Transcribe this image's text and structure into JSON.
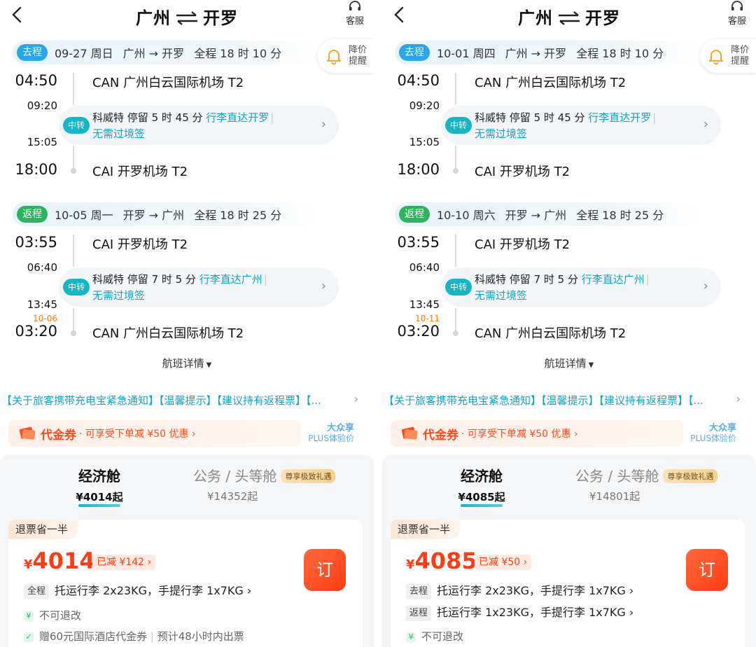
{
  "left": {
    "header": {
      "from": "广州",
      "to": "开罗",
      "service": "客服"
    },
    "alert": {
      "line1": "降价",
      "line2": "提醒"
    },
    "outbound": {
      "badge": "去程",
      "date": "09-27 周日",
      "route": "广州 → 开罗",
      "duration": "全程 18 时 10 分",
      "dep_time": "04:50",
      "dep_airport": "CAN 广州白云国际机场 T2",
      "transfer_arr": "09:20",
      "transfer_dep": "15:05",
      "transfer_tag": "中转",
      "transfer_city": "科威特",
      "transfer_stay": "停留 5 时 45 分",
      "transfer_bag": "行李直达开罗",
      "transfer_visa": "无需过境签",
      "arr_day": "",
      "arr_time": "18:00",
      "arr_airport": "CAI 开罗机场 T2"
    },
    "inbound": {
      "badge": "返程",
      "date": "10-05 周一",
      "route": "开罗 → 广州",
      "duration": "全程 18 时 25 分",
      "dep_time": "03:55",
      "dep_airport": "CAI 开罗机场 T2",
      "transfer_arr": "06:40",
      "transfer_dep": "13:45",
      "transfer_tag": "中转",
      "transfer_city": "科威特",
      "transfer_stay": "停留 7 时 5 分",
      "transfer_bag": "行李直达广州",
      "transfer_visa": "无需过境签",
      "arr_day": "10-06",
      "arr_time": "03:20",
      "arr_airport": "CAN 广州白云国际机场 T2"
    },
    "flight_detail": "航班详情",
    "notice": "【关于旅客携带充电宝紧急通知】【温馨提示】【建议持有返程票】【...",
    "coupon": {
      "title": "代金券",
      "desc": "· 可享受下单减 ¥50 优惠 ›"
    },
    "plus": {
      "line1": "大众享",
      "line2": "PLUS体验价"
    },
    "cabins": {
      "economy": {
        "name": "经济舱",
        "price": "¥4014起"
      },
      "business": {
        "name": "公务 / 头等舱",
        "vip": "尊享极致礼遇",
        "price": "¥14352起"
      }
    },
    "fare": {
      "refund": "退票省一半",
      "yen": "¥",
      "price": "4014",
      "discount": "已减  ¥142 ›",
      "book": "订",
      "bag1_tag": "全程",
      "bag1": "托运行李 2x23KG，手提行李 1x7KG ›",
      "cond1": "不可退改",
      "cond2": "赠60元国际酒店代金券",
      "cond2b": "预计48小时内出票"
    }
  },
  "right": {
    "header": {
      "from": "广州",
      "to": "开罗",
      "service": "客服"
    },
    "alert": {
      "line1": "降价",
      "line2": "提醒"
    },
    "outbound": {
      "badge": "去程",
      "date": "10-01 周四",
      "route": "广州 → 开罗",
      "duration": "全程 18 时 10 分",
      "dep_time": "04:50",
      "dep_airport": "CAN 广州白云国际机场 T2",
      "transfer_arr": "09:20",
      "transfer_dep": "15:05",
      "transfer_tag": "中转",
      "transfer_city": "科威特",
      "transfer_stay": "停留 5 时 45 分",
      "transfer_bag": "行李直达开罗",
      "transfer_visa": "无需过境签",
      "arr_day": "",
      "arr_time": "18:00",
      "arr_airport": "CAI 开罗机场 T2"
    },
    "inbound": {
      "badge": "返程",
      "date": "10-10 周六",
      "route": "开罗 → 广州",
      "duration": "全程 18 时 25 分",
      "dep_time": "03:55",
      "dep_airport": "CAI 开罗机场 T2",
      "transfer_arr": "06:40",
      "transfer_dep": "13:45",
      "transfer_tag": "中转",
      "transfer_city": "科威特",
      "transfer_stay": "停留 7 时 5 分",
      "transfer_bag": "行李直达广州",
      "transfer_visa": "无需过境签",
      "arr_day": "10-11",
      "arr_time": "03:20",
      "arr_airport": "CAN 广州白云国际机场 T2"
    },
    "flight_detail": "航班详情",
    "notice": "【关于旅客携带充电宝紧急通知】【温馨提示】【建议持有返程票】【...",
    "coupon": {
      "title": "代金券",
      "desc": "· 可享受下单减 ¥50 优惠 ›"
    },
    "plus": {
      "line1": "大众享",
      "line2": "PLUS体验价"
    },
    "cabins": {
      "economy": {
        "name": "经济舱",
        "price": "¥4085起"
      },
      "business": {
        "name": "公务 / 头等舱",
        "vip": "尊享极致礼遇",
        "price": "¥14801起"
      }
    },
    "fare": {
      "refund": "退票省一半",
      "yen": "¥",
      "price": "4085",
      "discount": "已减  ¥50 ›",
      "book": "订",
      "bag1_tag": "去程",
      "bag1": "托运行李 2x23KG，手提行李 1x7KG ›",
      "bag2_tag": "返程",
      "bag2": "托运行李 1x23KG，手提行李 1x7KG ›",
      "cond1": "不可退改"
    }
  },
  "colors": {
    "accent_teal": "#12a6c4",
    "price_red": "#ff3d14",
    "go_badge": "#2aa7e8",
    "back_badge": "#2db55d",
    "day_note": "#ff7a1a"
  }
}
